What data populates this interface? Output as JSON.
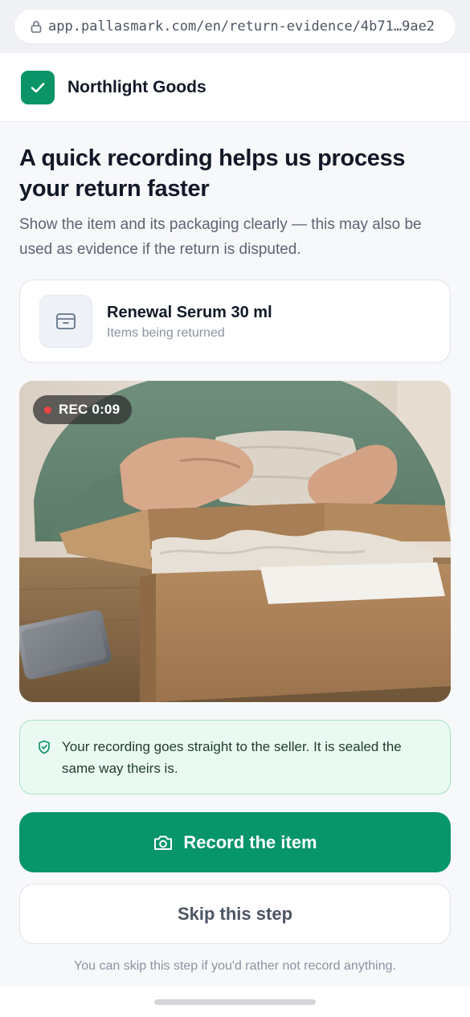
{
  "browser": {
    "url": "app.pallasmark.com/en/return-evidence/4b71…9ae2",
    "lock_icon": "lock-icon"
  },
  "header": {
    "brand_name": "Northlight Goods",
    "logo_icon": "check-icon",
    "brand_color": "#0a9467"
  },
  "main": {
    "title": "A quick recording helps us process your return faster",
    "subtitle": "Show the item and its packaging clearly — this may also be used as evidence if the return is disputed."
  },
  "item": {
    "name": "Renewal Serum 30 ml",
    "caption": "Items being returned",
    "icon": "archive-box-icon"
  },
  "recording": {
    "badge": "REC 0:09",
    "indicator_color": "#ef4444"
  },
  "notice": {
    "icon": "shield-check-icon",
    "text": "Your recording goes straight to the seller. It is sealed the same way theirs is."
  },
  "actions": {
    "record_label": "Record the item",
    "record_icon": "camera-icon",
    "skip_label": "Skip this step",
    "footnote": "You can skip this step if you'd rather not record anything."
  },
  "colors": {
    "accent": "#07956a",
    "notice_bg": "#eafaf2",
    "notice_border": "#a7e3c6"
  }
}
